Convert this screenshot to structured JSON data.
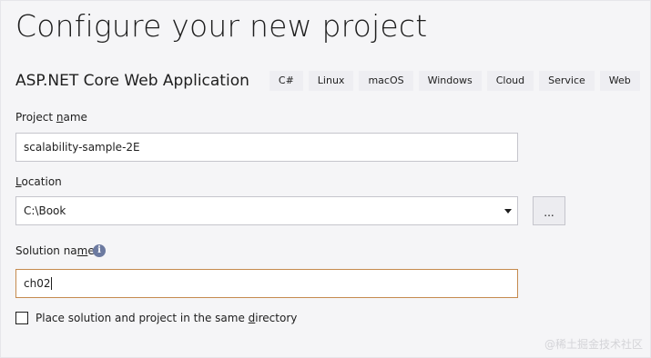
{
  "title": "Configure your new project",
  "template": {
    "name": "ASP.NET Core Web Application",
    "tags": [
      "C#",
      "Linux",
      "macOS",
      "Windows",
      "Cloud",
      "Service",
      "Web"
    ]
  },
  "project_name": {
    "label_before": "Project ",
    "label_accel": "n",
    "label_after": "ame",
    "value": "scalability-sample-2E"
  },
  "location": {
    "label_before": "",
    "label_accel": "L",
    "label_after": "ocation",
    "value": "C:\\Book",
    "browse_label": "..."
  },
  "solution_name": {
    "label_before": "Solution na",
    "label_accel": "m",
    "label_after": "e",
    "value": "ch02",
    "info_icon": "info-icon"
  },
  "same_directory": {
    "label_before": "Place solution and project in the same ",
    "label_accel": "d",
    "label_after": "irectory",
    "checked": false
  },
  "watermark": "@稀土掘金技术社区"
}
